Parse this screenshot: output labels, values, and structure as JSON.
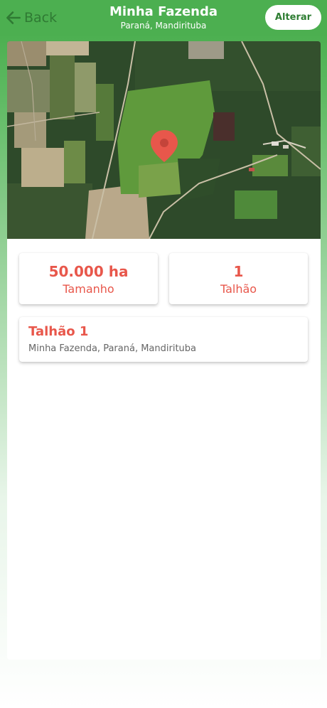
{
  "header": {
    "back_label": "Back",
    "title": "Minha Fazenda",
    "subtitle": "Paraná, Mandirituba",
    "edit_label": "Alterar"
  },
  "map": {
    "marker_icon": "location-pin-icon",
    "marker_color": "#e8574b"
  },
  "stats": [
    {
      "value": "50.000 ha",
      "label": "Tamanho"
    },
    {
      "value": "1",
      "label": "Talhão"
    }
  ],
  "plots": [
    {
      "name": "Talhão 1",
      "location": "Minha Fazenda, Paraná, Mandirituba"
    }
  ],
  "colors": {
    "header_green": "#4caf50",
    "accent_red": "#e8574b"
  }
}
